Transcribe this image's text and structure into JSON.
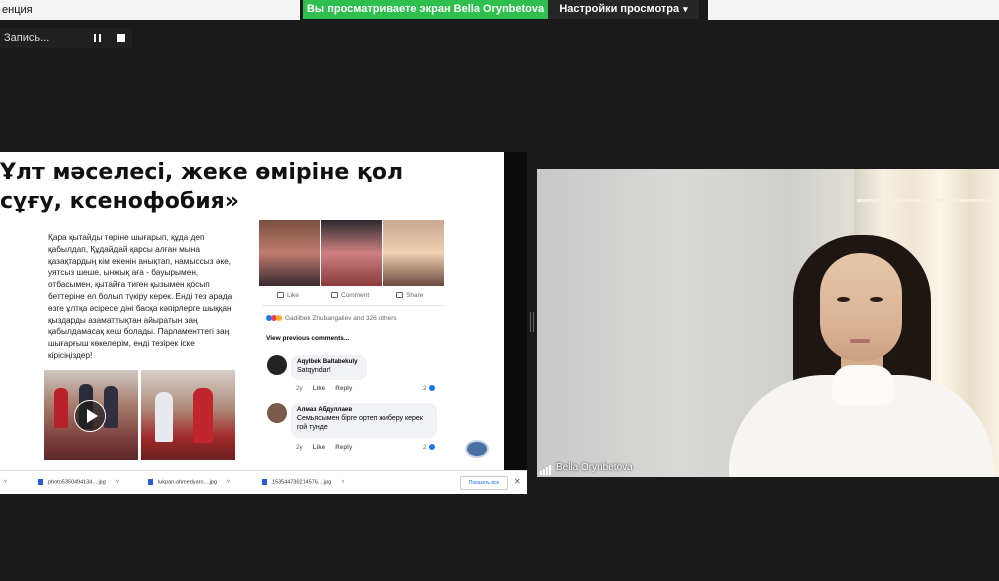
{
  "window": {
    "title": "енция",
    "share_banner": "Вы просматриваете экран Bella Orynbetova",
    "view_settings": "Настройки просмотра"
  },
  "recording": {
    "label": "Запись..."
  },
  "slide": {
    "title": "Ұлт мәселесі, жеке өміріне қол сұғу, ксенофобия»",
    "body": "Қара қытайды төріне шығарып, құда деп қабылдап, Құдайдай қарсы алған мына қазақтардың кім екенін анықтап, намыссыз әке, уятсыз шеше, ынжық аға - бауырымен, отбасымен, қытайға тиген қызымен қосып беттеріне ел болып түкіру керек. Енді  тез арада өзге ұлтқа әсіресе діні басқа кәпірлерге шыққан қыздарды азаматтықтан айыратын заң қабылдамасақ кеш болады. Парламенттегі заң шығарғыш көкелерім, енді тезірек  іске кірісіңіздер!"
  },
  "facebook": {
    "like": "Like",
    "comment": "Comment",
    "share": "Share",
    "reactions": "Gadilbek  Zhubangaliev and 326 others",
    "view_previous": "View previous comments...",
    "comments": [
      {
        "author": "Aqylbek Baltabekuly",
        "text": "Satqyndar!",
        "age": "2y",
        "like": "Like",
        "reply": "Reply",
        "count": "2"
      },
      {
        "author": "Алмаз Абдуллаев",
        "text": "Семьясымен бірге ортеп жиберу керек гой тунде",
        "age": "2y",
        "like": "Like",
        "reply": "Reply",
        "count": "2"
      }
    ]
  },
  "downloads": {
    "items": [
      {
        "name": "photo5350494134....jpg"
      },
      {
        "name": "lukpan-ahmedyaro....jpg"
      },
      {
        "name": "153544730214576....jpg"
      }
    ],
    "show_all": "Показать все",
    "close": "✕"
  },
  "video": {
    "participant_name": "Bella Orynbetova"
  },
  "colors": {
    "share_banner": "#2fbf4f",
    "background": "#1a1a1a",
    "fb_blue": "#1877f2"
  }
}
